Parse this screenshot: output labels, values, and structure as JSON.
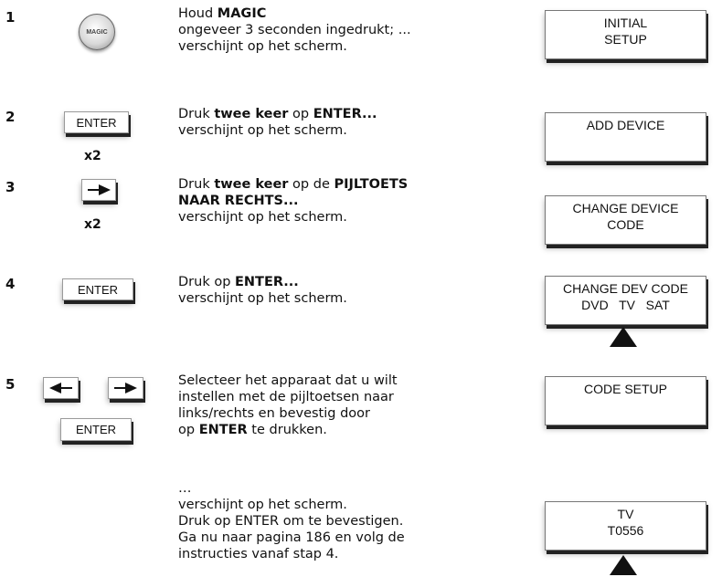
{
  "steps": [
    {
      "num": "1",
      "key_label": "MAGIC",
      "mult": "",
      "text": [
        [
          "Houd ",
          ""
        ],
        [
          "MAGIC",
          "b"
        ],
        [
          "\nongeveer 3 seconden ingedrukt; ...\nverschijnt op het scherm.",
          ""
        ]
      ],
      "display": [
        "INITIAL",
        "SETUP"
      ]
    },
    {
      "num": "2",
      "key_label": "ENTER",
      "mult": "x2",
      "text": [
        [
          "Druk ",
          ""
        ],
        [
          "twee keer",
          "b"
        ],
        [
          " op ",
          ""
        ],
        [
          "ENTER...",
          "b"
        ],
        [
          "\nverschijnt op het scherm.",
          ""
        ]
      ],
      "display": [
        "ADD DEVICE"
      ]
    },
    {
      "num": "3",
      "key_label": "",
      "mult": "x2",
      "text": [
        [
          "Druk ",
          ""
        ],
        [
          "twee keer",
          "b"
        ],
        [
          " op de ",
          ""
        ],
        [
          "PIJLTOETS\nNAAR RECHTS...",
          "b"
        ],
        [
          "\nverschijnt op het scherm.",
          ""
        ]
      ],
      "display": [
        "CHANGE DEVICE",
        "CODE"
      ]
    },
    {
      "num": "4",
      "key_label": "ENTER",
      "mult": "",
      "text": [
        [
          "Druk op ",
          ""
        ],
        [
          "ENTER...",
          "b"
        ],
        [
          "\nverschijnt op het scherm.",
          ""
        ]
      ],
      "display": [
        "CHANGE DEV CODE",
        "DVD   TV   SAT"
      ]
    },
    {
      "num": "5",
      "key_label": "ENTER",
      "mult": "",
      "text": [
        [
          "Selecteer het apparaat dat u wilt\ninstellen met de pijltoetsen naar\nlinks/rechts en bevestig door\nop ",
          ""
        ],
        [
          "ENTER",
          "b"
        ],
        [
          " te drukken.",
          ""
        ]
      ],
      "display": [
        "CODE SETUP"
      ]
    }
  ],
  "final": {
    "text": "…\nverschijnt op het scherm.\nDruk op ENTER om te bevestigen.\nGa nu naar pagina 186 en volg de\ninstructies vanaf stap 4.",
    "display": [
      "TV",
      "T0556"
    ]
  },
  "icons": {
    "right_arrow": "right-arrow-icon",
    "left_arrow": "left-arrow-icon",
    "pointer": "pointer-triangle-icon"
  }
}
